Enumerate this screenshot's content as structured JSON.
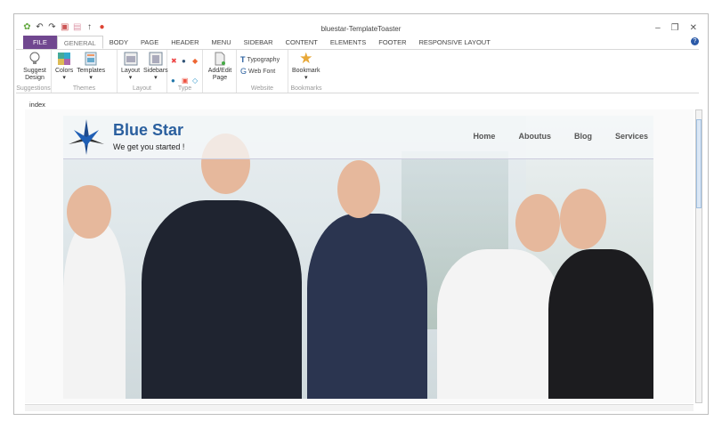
{
  "window": {
    "title": "bluestar-TemplateToaster",
    "minimize": "–",
    "restore": "❐",
    "close": "✕",
    "help": "?"
  },
  "quick_access": [
    "save-icon",
    "undo-icon",
    "redo-icon",
    "save-icon",
    "open-icon",
    "upload-icon",
    "browser-icon"
  ],
  "tabs": [
    "FILE",
    "GENERAL",
    "BODY",
    "PAGE",
    "HEADER",
    "MENU",
    "SIDEBAR",
    "CONTENT",
    "ELEMENTS",
    "FOOTER",
    "RESPONSIVE LAYOUT"
  ],
  "ribbon": {
    "suggestions": {
      "label": "Suggestions",
      "button": "Suggest Design"
    },
    "themes": {
      "label": "Themes",
      "colors": "Colors",
      "templates": "Templates"
    },
    "layout": {
      "label": "Layout",
      "layout": "Layout",
      "sidebars": "Sidebars"
    },
    "type": {
      "label": "Type"
    },
    "page": {
      "button": "Add/Edit Page"
    },
    "website": {
      "label": "Website",
      "typography": "Typography",
      "webfont": "Web Font"
    },
    "bookmarks": {
      "label": "Bookmarks",
      "bookmark": "Bookmark"
    }
  },
  "document_tab": "index",
  "site": {
    "brand": "Blue Star",
    "tagline": "We get you started !",
    "nav": [
      "Home",
      "Aboutus",
      "Blog",
      "Services"
    ]
  },
  "colors": {
    "file_tab": "#70478f",
    "brand": "#2a5f9e"
  }
}
